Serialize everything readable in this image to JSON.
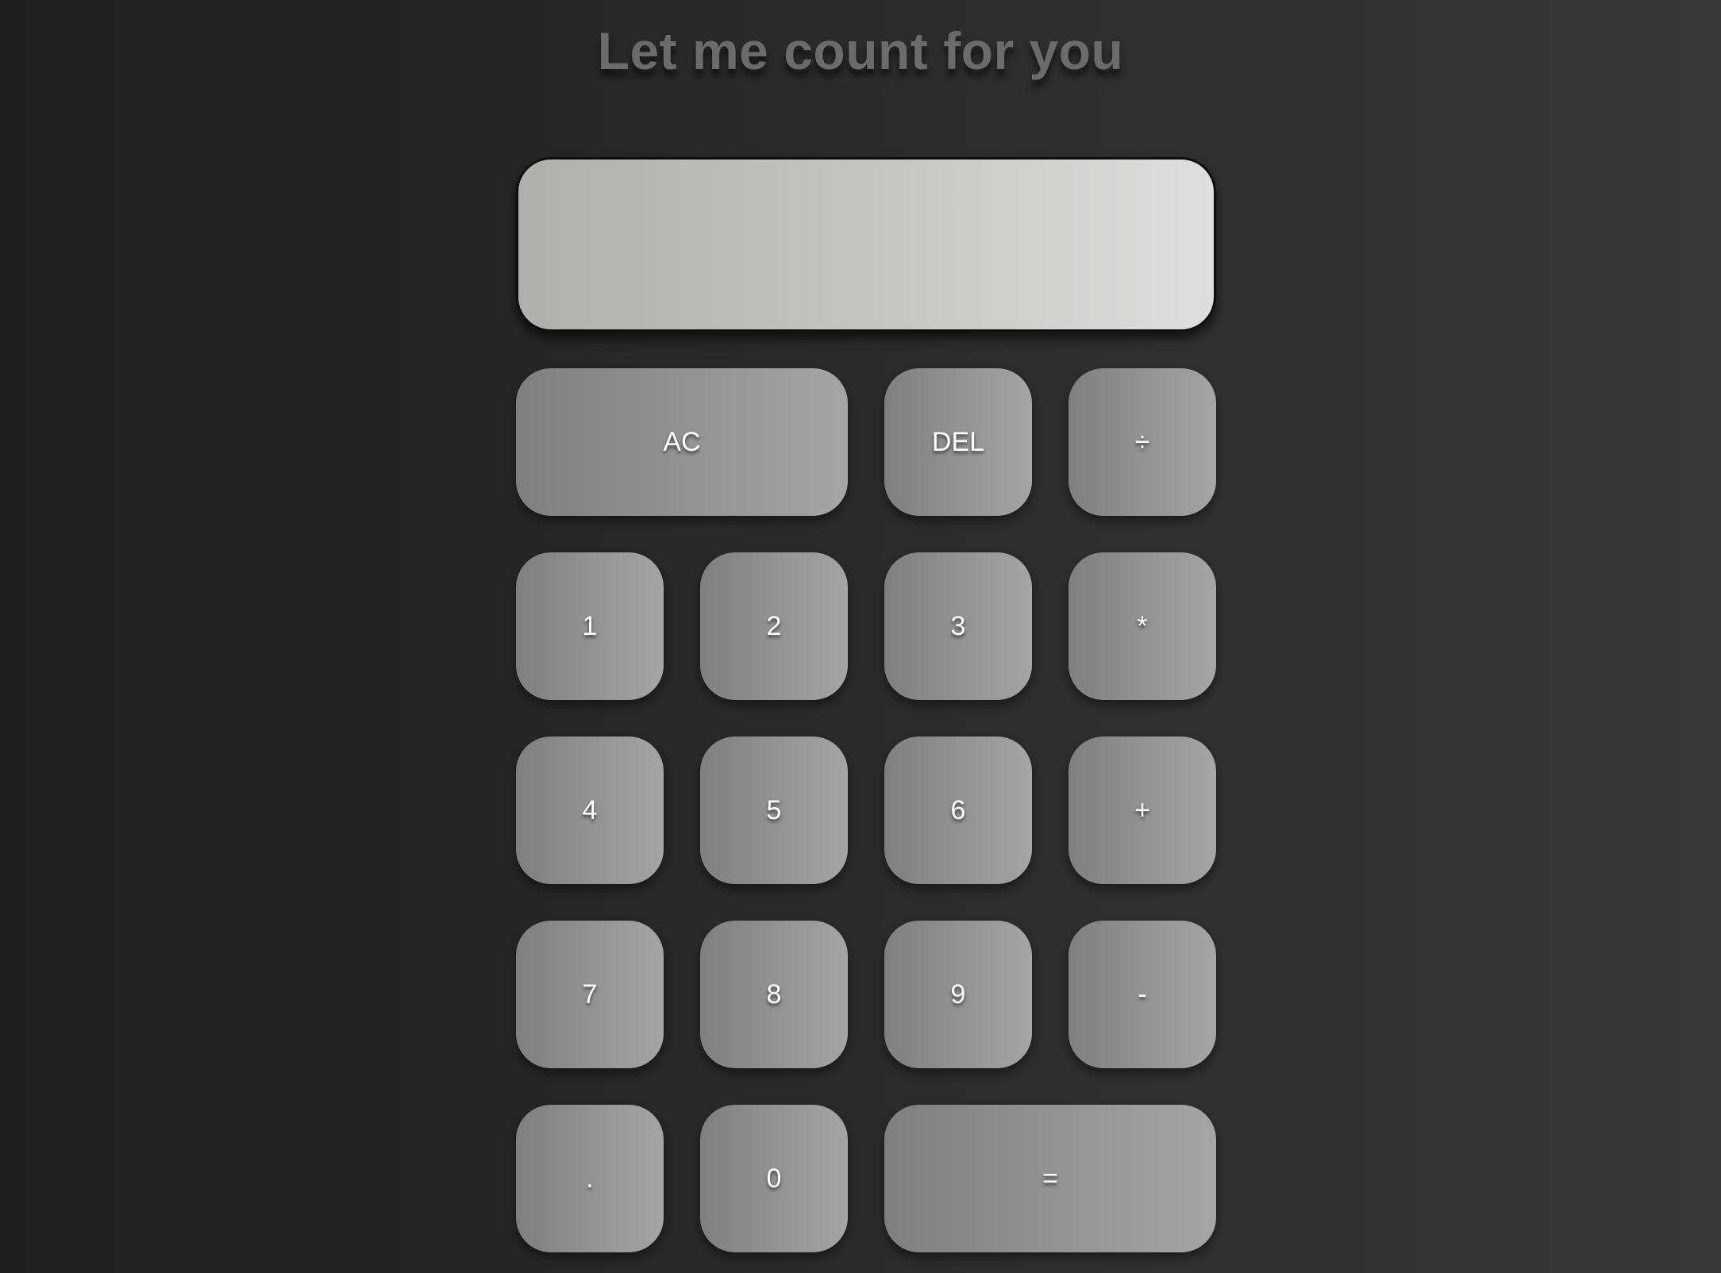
{
  "header": {
    "title": "Let me count for you"
  },
  "display": {
    "value": ""
  },
  "keys": {
    "ac": "AC",
    "del": "DEL",
    "divide": "÷",
    "one": "1",
    "two": "2",
    "three": "3",
    "multiply": "*",
    "four": "4",
    "five": "5",
    "six": "6",
    "plus": "+",
    "seven": "7",
    "eight": "8",
    "nine": "9",
    "minus": "-",
    "dot": ".",
    "zero": "0",
    "equals": "="
  },
  "colors": {
    "background": "#2b2b2b",
    "title": "#6b6b6b",
    "key_gradient_start": "#7f7f7f",
    "key_gradient_end": "#a5a5a5",
    "display_gradient_start": "#afafad",
    "display_gradient_end": "#dedede",
    "key_text": "#ffffff"
  }
}
